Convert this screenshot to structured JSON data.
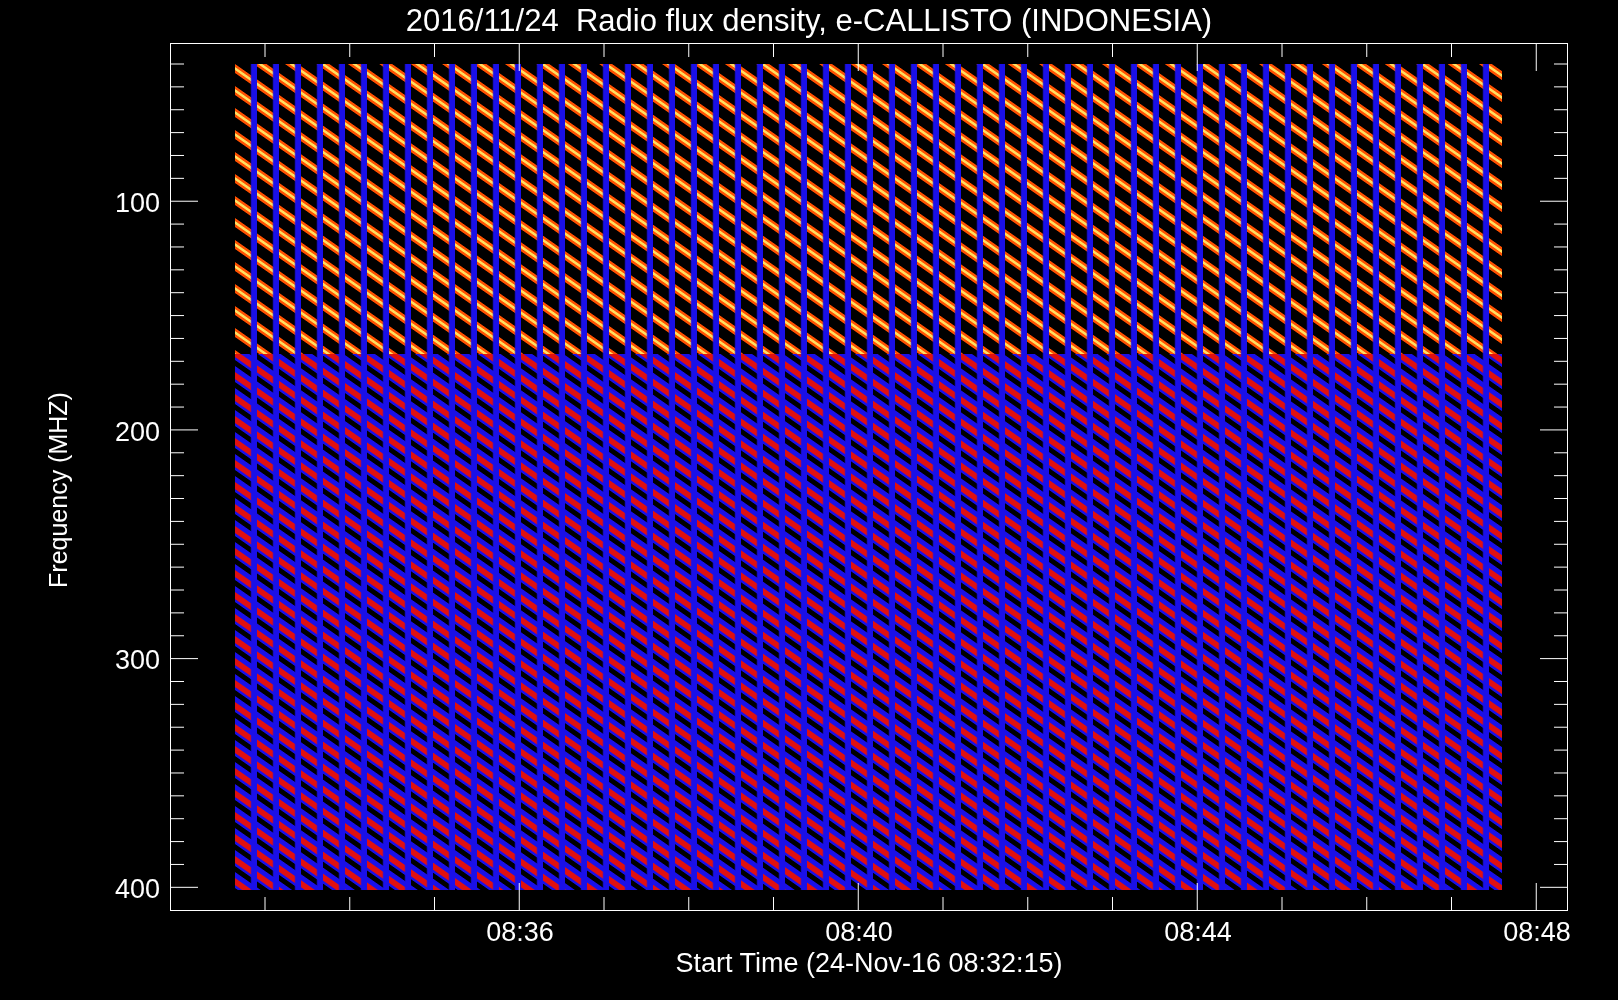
{
  "title": "2016/11/24  Radio flux density, e-CALLISTO (INDONESIA)",
  "y_axis": {
    "label": "Frequency (MHZ)",
    "ticks": [
      "100",
      "200",
      "300",
      "400"
    ]
  },
  "x_axis": {
    "label": "Start Time (24-Nov-16 08:32:15)",
    "ticks": [
      "08:36",
      "08:40",
      "08:44",
      "08:48"
    ]
  }
}
